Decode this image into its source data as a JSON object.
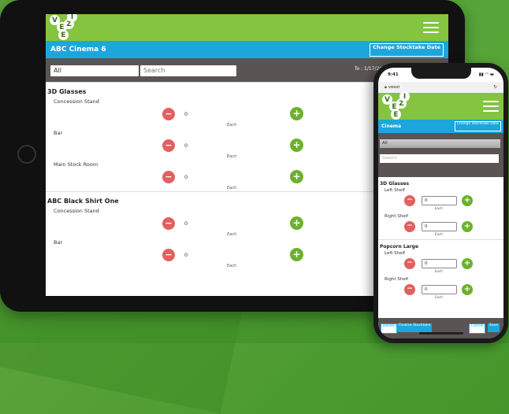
{
  "tablet": {
    "logo_letters": [
      "V",
      "E",
      "Z",
      "I",
      "E"
    ],
    "cinema": "ABC Cinema 6",
    "change_btn": "Change Stocktake Date",
    "filter_all": "All",
    "search_placeholder": "Search",
    "to_text": "To : 1/17/2019 6:00:00 AM",
    "groups": [
      {
        "title": "3D Glasses",
        "rows": [
          {
            "location": "Concession Stand",
            "value": "0",
            "unit": "Each"
          },
          {
            "location": "Bar",
            "value": "0",
            "unit": "Each"
          },
          {
            "location": "Main Stock Room",
            "value": "0",
            "unit": "Each"
          }
        ]
      },
      {
        "title": "ABC Black Shirt One",
        "rows": [
          {
            "location": "Concession Stand",
            "value": "0",
            "unit": "Each"
          },
          {
            "location": "Bar",
            "value": "0",
            "unit": "Each"
          }
        ]
      }
    ]
  },
  "phone": {
    "time": "9:41",
    "url": "veezi",
    "cinema": "Cinema",
    "change_btn": "Change Stocktake Date",
    "filter_all": "All",
    "search_placeholder": "Search",
    "groups": [
      {
        "title": "3D Glasses",
        "rows": [
          {
            "location": "Left Shelf",
            "value": "0",
            "unit": "Each"
          },
          {
            "location": "Right Shelf",
            "value": "0",
            "unit": "Each"
          }
        ]
      },
      {
        "title": "Popcorn Large",
        "rows": [
          {
            "location": "Left Shelf",
            "value": "0",
            "unit": "Each"
          },
          {
            "location": "Right Shelf",
            "value": "0",
            "unit": "Each"
          }
        ]
      }
    ],
    "footer": {
      "delete": "Delete",
      "finalise": "Finalise Stocktake",
      "cancel": "Cancel",
      "save": "Save"
    }
  },
  "colors": {
    "green": "#84c43f",
    "blue": "#1ba7dd",
    "dark": "#5a5452",
    "minus": "#e2605f",
    "plus": "#6cb12d"
  }
}
